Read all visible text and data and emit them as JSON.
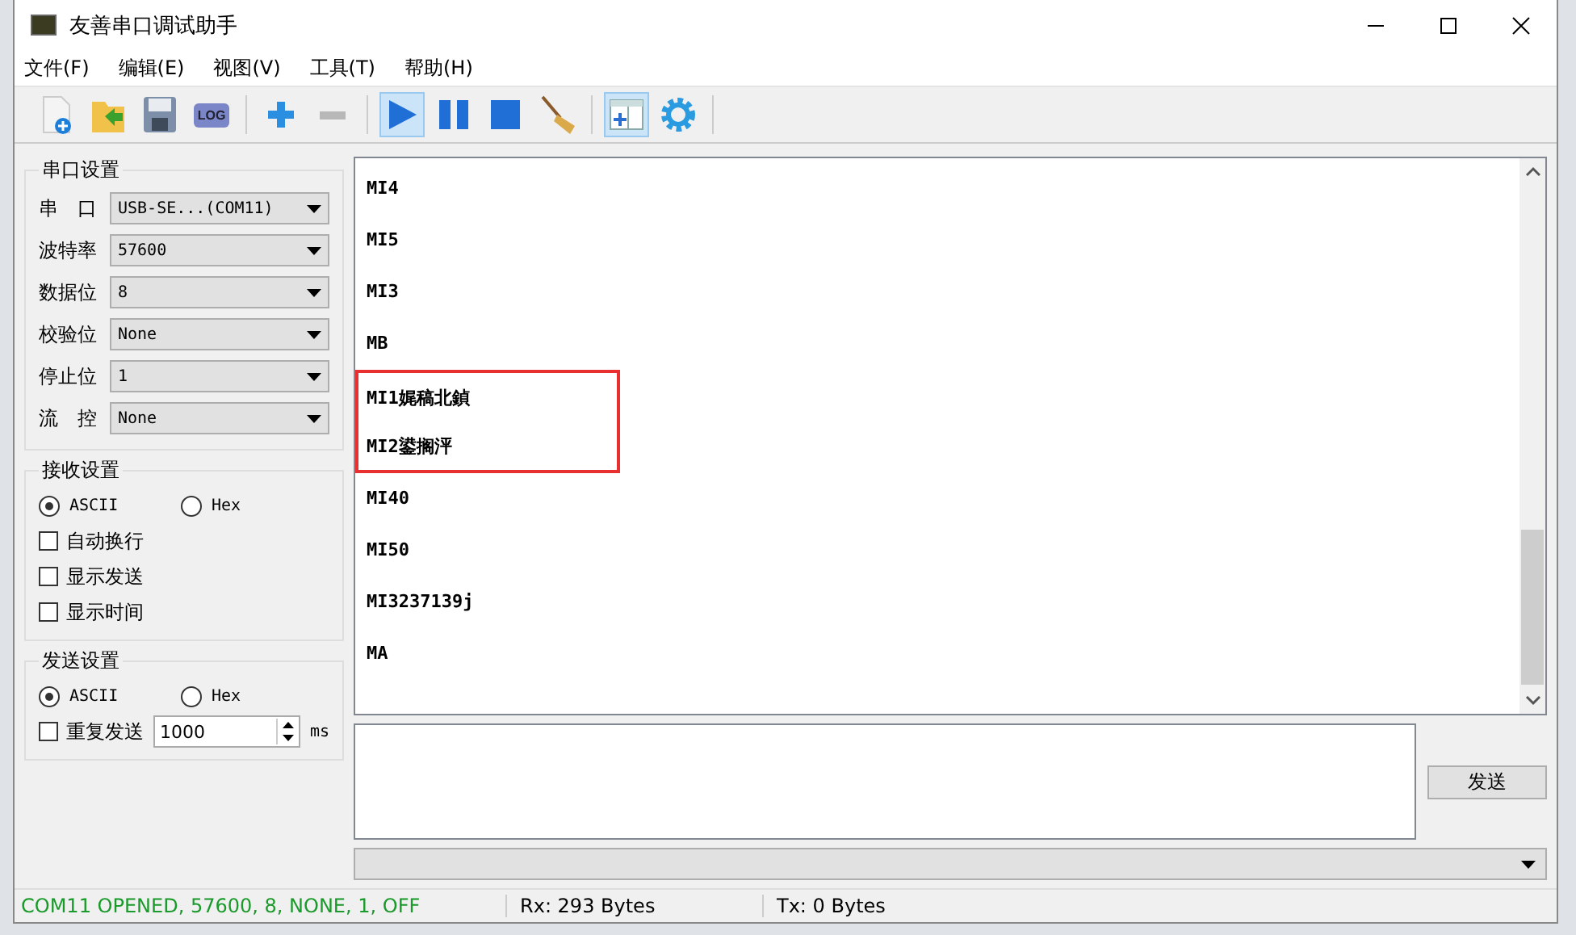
{
  "window": {
    "title": "友善串口调试助手"
  },
  "menu": [
    "文件(F)",
    "编辑(E)",
    "视图(V)",
    "工具(T)",
    "帮助(H)"
  ],
  "toolbar": [
    {
      "kind": "new",
      "selected": false
    },
    {
      "kind": "open",
      "selected": false
    },
    {
      "kind": "save",
      "selected": false
    },
    {
      "kind": "log",
      "label": "LOG",
      "selected": false
    },
    {
      "kind": "sep"
    },
    {
      "kind": "add",
      "selected": false
    },
    {
      "kind": "remove",
      "selected": false
    },
    {
      "kind": "sep"
    },
    {
      "kind": "play",
      "selected": true
    },
    {
      "kind": "pause",
      "selected": false
    },
    {
      "kind": "stop",
      "selected": false
    },
    {
      "kind": "broom",
      "selected": false
    },
    {
      "kind": "sep"
    },
    {
      "kind": "view",
      "selected": true
    },
    {
      "kind": "gear",
      "selected": false
    },
    {
      "kind": "sep"
    }
  ],
  "serial_settings": {
    "title": "串口设置",
    "fields": [
      {
        "label": "串　口",
        "value": "USB-SE...(COM11)"
      },
      {
        "label": "波特率",
        "value": "57600"
      },
      {
        "label": "数据位",
        "value": "8"
      },
      {
        "label": "校验位",
        "value": "None"
      },
      {
        "label": "停止位",
        "value": "1"
      },
      {
        "label": "流　控",
        "value": "None"
      }
    ]
  },
  "receive_settings": {
    "title": "接收设置",
    "modes": [
      {
        "label": "ASCII",
        "selected": true
      },
      {
        "label": "Hex",
        "selected": false
      }
    ],
    "options": [
      {
        "label": "自动换行",
        "checked": false
      },
      {
        "label": "显示发送",
        "checked": false
      },
      {
        "label": "显示时间",
        "checked": false
      }
    ]
  },
  "send_settings": {
    "title": "发送设置",
    "modes": [
      {
        "label": "ASCII",
        "selected": true
      },
      {
        "label": "Hex",
        "selected": false
      }
    ],
    "repeat": {
      "label": "重复发送",
      "checked": false,
      "value": "1000",
      "unit": "ms"
    }
  },
  "receive_log": [
    {
      "text": "MI4",
      "highlighted": false
    },
    {
      "text": "MI5",
      "highlighted": false
    },
    {
      "text": "MI3",
      "highlighted": false
    },
    {
      "text": "MB",
      "highlighted": false
    },
    {
      "text": "MI1娓稿北鍞",
      "highlighted": true
    },
    {
      "text": "MI2鍙搁泙",
      "highlighted": true
    },
    {
      "text": "MI40",
      "highlighted": false
    },
    {
      "text": "MI50",
      "highlighted": false
    },
    {
      "text": "MI3237139j",
      "highlighted": false
    },
    {
      "text": "MA",
      "highlighted": false
    }
  ],
  "send_button": "发送",
  "status_bar": {
    "connection": "COM11 OPENED, 57600, 8, NONE, 1, OFF",
    "rx": "Rx: 293 Bytes",
    "tx": "Tx: 0 Bytes"
  }
}
